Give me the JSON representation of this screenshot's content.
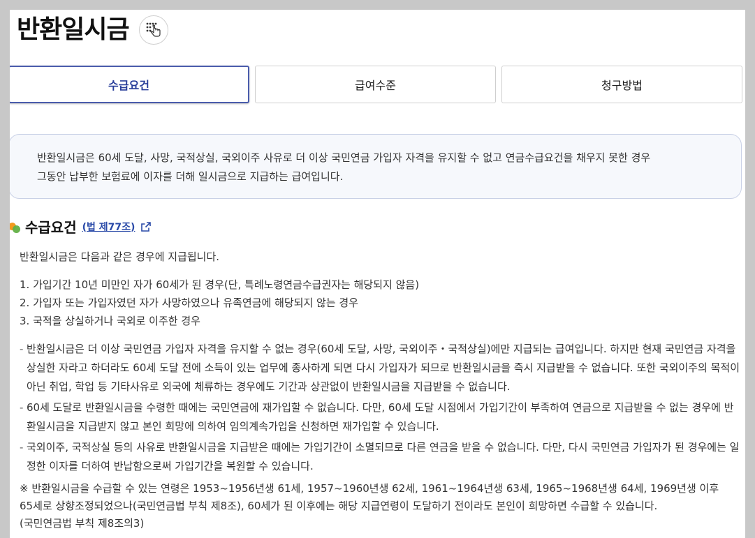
{
  "page": {
    "title": "반환일시금"
  },
  "tabs": [
    {
      "label": "수급요건",
      "active": true
    },
    {
      "label": "급여수준",
      "active": false
    },
    {
      "label": "청구방법",
      "active": false
    }
  ],
  "summary": {
    "line1": "반환일시금은 60세 도달, 사망, 국적상실, 국외이주 사유로 더 이상 국민연금 가입자 자격을 유지할 수 없고 연금수급요건을 채우지 못한 경우",
    "line2": "그동안 납부한 보험료에 이자를 더해 일시금으로 지급하는 급여입니다."
  },
  "section": {
    "title": "수급요건",
    "law_link": "(법 제77조)",
    "intro": "반환일시금은 다음과 같은 경우에 지급됩니다.",
    "conditions": [
      "1. 가입기간 10년 미만인 자가 60세가 된 경우(단, 특례노령연금수급권자는 해당되지 않음)",
      "2. 가입자 또는 가입자였던 자가 사망하였으나 유족연금에 해당되지 않는 경우",
      "3. 국적을 상실하거나 국외로 이주한 경우"
    ],
    "notes": [
      "반환일시금은 더 이상 국민연금 가입자 자격을 유지할 수 없는 경우(60세 도달, 사망, 국외이주・국적상실)에만 지급되는 급여입니다. 하지만 현재 국민연금 자격을 상실한 자라고 하더라도 60세 도달 전에 소득이 있는 업무에 종사하게 되면 다시 가입자가 되므로 반환일시금을 즉시 지급받을 수 없습니다. 또한 국외이주의 목적이 아닌 취업, 학업 등 기타사유로 외국에 체류하는 경우에도 기간과 상관없이 반환일시금을 지급받을 수 없습니다.",
      "60세 도달로 반환일시금을 수령한 때에는 국민연금에 재가입할 수 없습니다. 다만, 60세 도달 시점에서 가입기간이 부족하여 연금으로 지급받을 수 없는 경우에 반환일시금을 지급받지 않고 본인 희망에 의하여 임의계속가입을 신청하면 재가입할 수 있습니다.",
      "국외이주, 국적상실 등의 사유로 반환일시금을 지급받은 때에는 가입기간이 소멸되므로 다른 연금을 받을 수 없습니다. 다만, 다시 국민연금 가입자가 된 경우에는 일정한 이자를 더하여 반납함으로써 가입기간을 복원할 수 있습니다."
    ],
    "remark_line1": "※ 반환일시금을 수급할 수 있는 연령은 1953~1956년생 61세, 1957~1960년생 62세, 1961~1964년생 63세, 1965~1968년생 64세, 1969년생 이후",
    "remark_line2": "65세로 상향조정되었으나(국민연금법 부칙 제8조), 60세가 된 이후에는 해당 지급연령이 도달하기 전이라도 본인이 희망하면 수급할 수 있습니다.",
    "remark_line3": "(국민연금법 부칙 제8조의3)"
  },
  "colors": {
    "accent": "#2a3f9a",
    "tab_border_active": "#4a5cac",
    "summary_bg": "#f6f8fc",
    "link": "#2a4aa8",
    "dot_orange": "#f39a1e",
    "dot_green": "#62b046"
  },
  "icons": {
    "gesture": "braille-hand-icon",
    "external_link": "external-link-icon",
    "section_bullet": "two-dot-bullet-icon"
  }
}
